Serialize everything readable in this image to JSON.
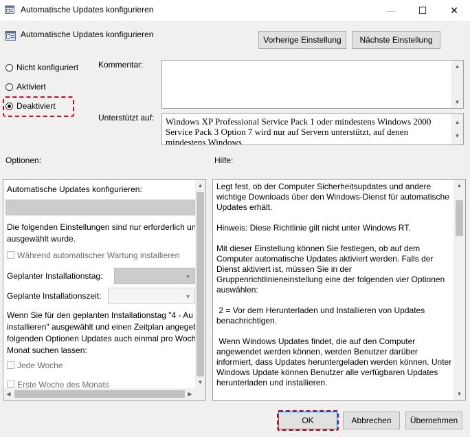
{
  "window": {
    "title": "Automatische Updates konfigurieren",
    "controls": {
      "minimize": "—",
      "maximize": "☐",
      "close": "✕"
    }
  },
  "header": {
    "policy_name": "Automatische Updates konfigurieren",
    "prev_button": "Vorherige Einstellung",
    "next_button": "Nächste Einstellung"
  },
  "state": {
    "options": [
      {
        "label": "Nicht konfiguriert",
        "checked": false
      },
      {
        "label": "Aktiviert",
        "checked": false
      },
      {
        "label": "Deaktiviert",
        "checked": true
      }
    ]
  },
  "comment": {
    "label": "Kommentar:",
    "value": ""
  },
  "supported": {
    "label": "Unterstützt auf:",
    "text": "Windows XP Professional Service Pack 1 oder mindestens Windows 2000 Service Pack 3 Option 7 wird nur auf Servern unterstützt, auf denen mindestens Windows"
  },
  "options_section": {
    "label": "Optionen:",
    "title": "Automatische Updates konfigurieren:",
    "note_line1": "Die folgenden Einstellungen sind nur erforderlich un",
    "note_line2": "ausgewählt wurde.",
    "maintenance_checkbox": "Während automatischer Wartung installieren",
    "install_day_label": "Geplanter Installationstag:",
    "install_time_label": "Geplante Installationszeit:",
    "para_line1": "Wenn Sie für den geplanten Installationstag \"4 - Au",
    "para_line2": "installieren\" ausgewählt und einen Zeitplan angegeb",
    "para_line3": "folgenden Optionen Updates auch einmal pro Woch",
    "para_line4": "Monat suchen lassen:",
    "every_week": "Jede Woche",
    "first_week": "Erste Woche des Monats"
  },
  "help_section": {
    "label": "Hilfe:",
    "p1": "Legt fest, ob der Computer Sicherheitsupdates und andere wichtige Downloads über den Windows-Dienst für automatische Updates erhält.",
    "p2": "Hinweis: Diese Richtlinie gilt nicht unter Windows RT.",
    "p3": "Mit dieser Einstellung können Sie festlegen, ob auf dem Computer automatische Updates aktiviert werden. Falls der Dienst aktiviert ist, müssen Sie in der Gruppenrichtlinieneinstellung eine der folgenden vier Optionen auswählen:",
    "p4": " 2 = Vor dem Herunterladen und Installieren von Updates benachrichtigen.",
    "p5": " Wenn Windows Updates findet, die auf den Computer angewendet werden können, werden Benutzer darüber informiert, dass Updates heruntergeladen werden können. Unter Windows Update können Benutzer alle verfügbaren Updates herunterladen und installieren."
  },
  "footer": {
    "ok": "OK",
    "cancel": "Abbrechen",
    "apply": "Übernehmen"
  },
  "colors": {
    "highlight": "#e0001b",
    "background": "#f0f0f0",
    "button": "#e1e1e1"
  },
  "icons": [
    "app-icon",
    "policy-icon",
    "minimize-icon",
    "maximize-icon",
    "close-icon",
    "scroll-up-icon",
    "scroll-down-icon",
    "scroll-left-icon",
    "scroll-right-icon",
    "dropdown-arrow-icon"
  ]
}
